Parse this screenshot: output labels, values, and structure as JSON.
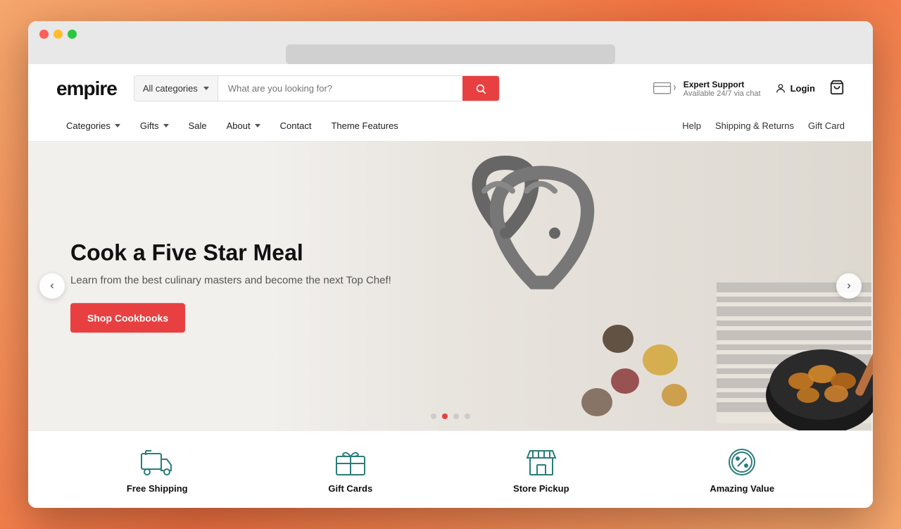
{
  "browser": {
    "url_bar": ""
  },
  "header": {
    "logo": "empire",
    "search": {
      "category_label": "All categories",
      "placeholder": "What are you looking for?",
      "button_label": "Search"
    },
    "support": {
      "title": "Expert Support",
      "subtitle": "Available 24/7 via chat"
    },
    "login_label": "Login",
    "cart_label": "Cart"
  },
  "nav": {
    "left_items": [
      {
        "label": "Categories",
        "has_dropdown": true
      },
      {
        "label": "Gifts",
        "has_dropdown": true
      },
      {
        "label": "Sale",
        "has_dropdown": false
      },
      {
        "label": "About",
        "has_dropdown": true
      },
      {
        "label": "Contact",
        "has_dropdown": false
      },
      {
        "label": "Theme Features",
        "has_dropdown": false
      }
    ],
    "right_items": [
      {
        "label": "Help"
      },
      {
        "label": "Shipping & Returns"
      },
      {
        "label": "Gift Card"
      }
    ]
  },
  "hero": {
    "title": "Cook a Five Star Meal",
    "subtitle": "Learn from the best culinary masters and become the next Top Chef!",
    "cta_label": "Shop Cookbooks",
    "dots": [
      {
        "active": false
      },
      {
        "active": true
      },
      {
        "active": false
      },
      {
        "active": false
      }
    ]
  },
  "features": [
    {
      "icon": "truck-icon",
      "label": "Free Shipping"
    },
    {
      "icon": "gift-card-icon",
      "label": "Gift Cards"
    },
    {
      "icon": "store-icon",
      "label": "Store Pickup"
    },
    {
      "icon": "percent-icon",
      "label": "Amazing Value"
    }
  ]
}
